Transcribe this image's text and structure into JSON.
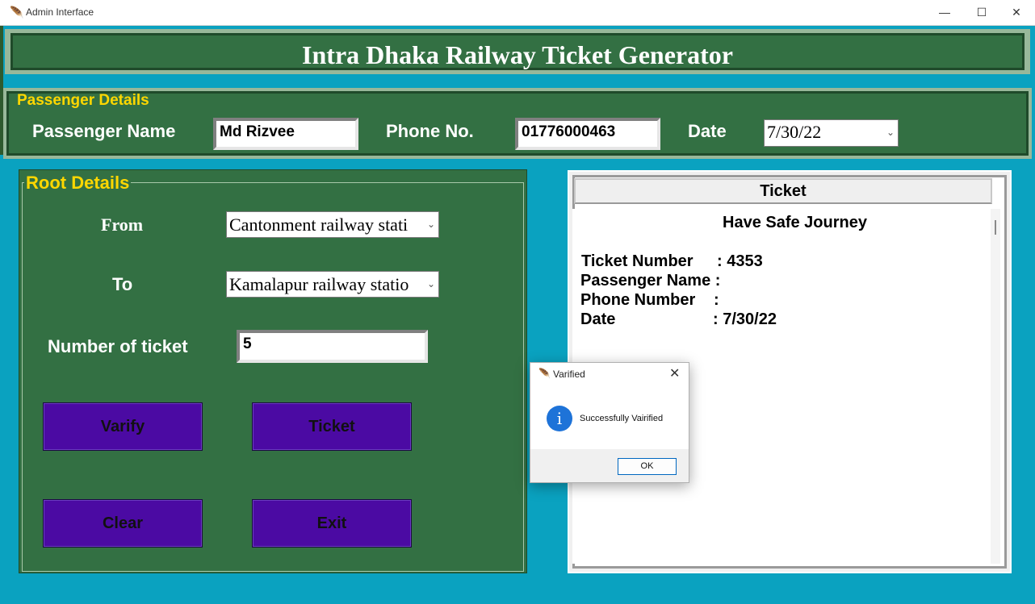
{
  "window": {
    "title": "Admin Interface",
    "minimize_glyph": "—",
    "maximize_glyph": "☐",
    "close_glyph": "✕"
  },
  "header": {
    "title": "Intra Dhaka Railway Ticket Generator"
  },
  "passenger": {
    "legend": "Passenger Details",
    "name_label": "Passenger Name",
    "name_value": "Md Rizvee",
    "phone_label": "Phone No.",
    "phone_value": "01776000463",
    "date_label": "Date",
    "date_value": "7/30/22"
  },
  "root": {
    "legend": "Root Details",
    "from_label": "From",
    "from_value": "Cantonment railway stati",
    "to_label": "To",
    "to_value": "Kamalapur railway statio",
    "tickets_label": "Number of ticket",
    "tickets_value": "5",
    "buttons": {
      "verify": "Varify",
      "ticket": "Ticket",
      "clear": "Clear",
      "exit": "Exit"
    }
  },
  "ticket": {
    "header": "Ticket",
    "greeting": "Have Safe Journey",
    "number_label": "Ticket Number",
    "number_value": ": 4353",
    "name_label": "Passenger Name :",
    "phone_label": "Phone Number",
    "phone_colon": ":",
    "date_label": "Date",
    "date_value": ": 7/30/22"
  },
  "dialog": {
    "title": "Varified",
    "message": "Successfully Vairified",
    "ok_label": "OK",
    "close_glyph": "✕",
    "info_glyph": "i"
  },
  "colors": {
    "background": "#0aa2c0",
    "panel_green": "#337043",
    "legend_yellow": "#ffd700",
    "button_purple": "#4b0aa3"
  }
}
